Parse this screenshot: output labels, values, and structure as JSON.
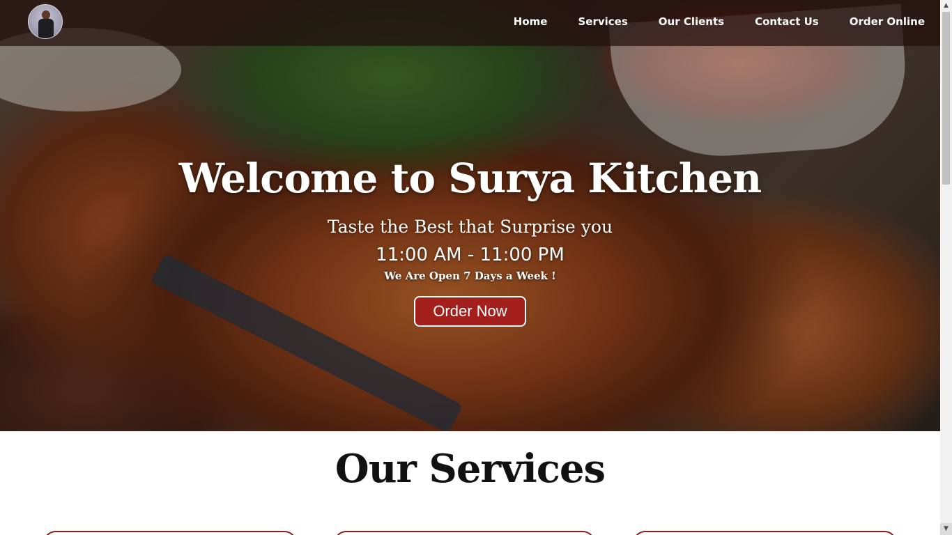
{
  "nav": {
    "logo_icon": "profile-avatar-icon",
    "links": [
      "Home",
      "Services",
      "Our Clients",
      "Contact Us",
      "Order Online"
    ]
  },
  "hero": {
    "title": "Welcome to Surya Kitchen",
    "tagline": "Taste the Best that Surprise you",
    "hours": "11:00 AM - 11:00 PM",
    "open_days": "We Are Open 7 Days a Week !",
    "button_label": "Order Now"
  },
  "services": {
    "title": "Our Services"
  },
  "colors": {
    "accent": "#a3201c",
    "nav_bg": "#230e0c",
    "text_light": "#ffffff"
  },
  "scrollbar": {
    "up_icon": "scroll-up-arrow-icon",
    "down_icon": "scroll-down-arrow-icon"
  }
}
